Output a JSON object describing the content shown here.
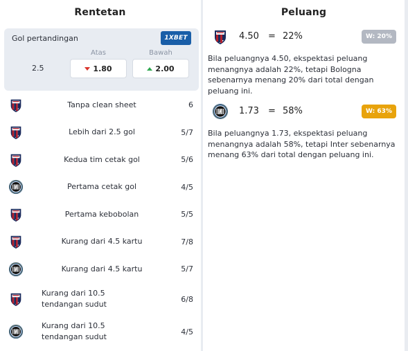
{
  "left_panel": {
    "title": "Rentetan",
    "odds": {
      "label": "Gol pertandingan",
      "bookmaker": "1XBET",
      "over_header": "Atas",
      "under_header": "Bawah",
      "line": "2.5",
      "over_odd": "1.80",
      "over_trend": "down",
      "under_odd": "2.00",
      "under_trend": "up"
    },
    "streaks": [
      {
        "team_icon": "bologna-crest-icon",
        "label": "Tanpa clean sheet",
        "value": "6"
      },
      {
        "team_icon": "bologna-crest-icon",
        "label": "Lebih dari 2.5 gol",
        "value": "5/7"
      },
      {
        "team_icon": "bologna-crest-icon",
        "label": "Kedua tim cetak gol",
        "value": "5/6"
      },
      {
        "team_icon": "inter-crest-icon",
        "label": "Pertama cetak gol",
        "value": "4/5"
      },
      {
        "team_icon": "bologna-crest-icon",
        "label": "Pertama kebobolan",
        "value": "5/5"
      },
      {
        "team_icon": "bologna-crest-icon",
        "label": "Kurang dari 4.5 kartu",
        "value": "7/8"
      },
      {
        "team_icon": "inter-crest-icon",
        "label": "Kurang dari 4.5 kartu",
        "value": "5/7"
      },
      {
        "team_icon": "bologna-crest-icon",
        "label": "Kurang dari 10.5 tendangan sudut",
        "value": "6/8"
      },
      {
        "team_icon": "inter-crest-icon",
        "label": "Kurang dari 10.5 tendangan sudut",
        "value": "4/5"
      }
    ]
  },
  "right_panel": {
    "title": "Peluang",
    "items": [
      {
        "team_icon": "bologna-crest-icon",
        "odd": "4.50",
        "eq": "=",
        "pct": "22%",
        "badge": "W: 20%",
        "badge_color": "#b3b8c2",
        "desc": "Bila peluangnya 4.50, ekspektasi peluang menangnya adalah 22%, tetapi Bologna sebenarnya menang 20% dari total dengan peluang ini."
      },
      {
        "team_icon": "inter-crest-icon",
        "odd": "1.73",
        "eq": "=",
        "pct": "58%",
        "badge": "W: 63%",
        "badge_color": "#e8a30c",
        "desc": "Bila peluangnya 1.73, ekspektasi peluang menangnya adalah 58%, tetapi Inter sebenarnya menang 63% dari total dengan peluang ini."
      }
    ]
  },
  "colors": {
    "bologna_red": "#b4202d",
    "bologna_navy": "#1a2a5c",
    "inter_blue": "#0b4da2",
    "inter_black": "#111111",
    "accent_up": "#2fa84f",
    "accent_down": "#d9342b",
    "bookmaker_blue": "#195ea8"
  }
}
